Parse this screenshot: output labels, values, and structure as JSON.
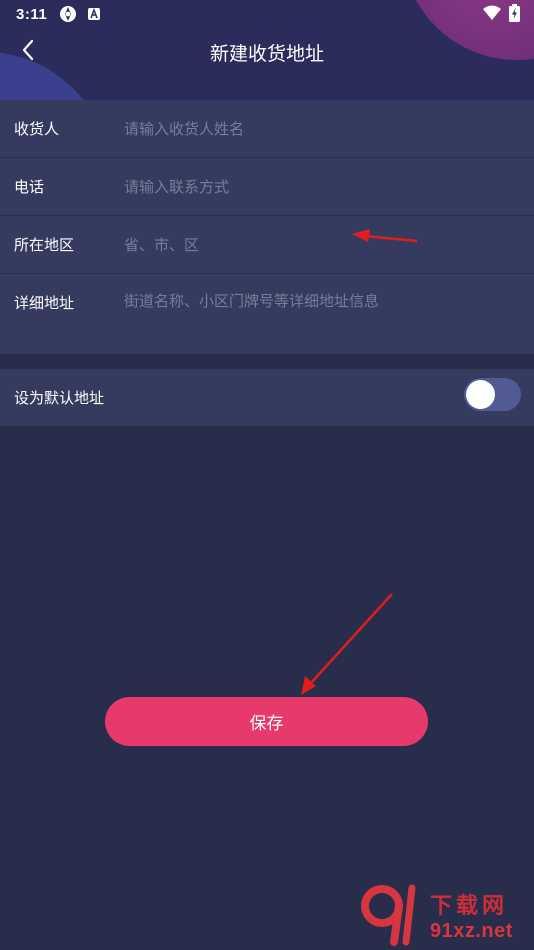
{
  "status_bar": {
    "time": "3:11",
    "left_icons": [
      "vpn-icon",
      "app-notification-icon"
    ],
    "right_icons": [
      "wifi-icon",
      "battery-charging-icon"
    ]
  },
  "header": {
    "title": "新建收货地址",
    "back_icon": "chevron-left-icon"
  },
  "form": {
    "receiver": {
      "label": "收货人",
      "placeholder": "请输入收货人姓名",
      "value": ""
    },
    "phone": {
      "label": "电话",
      "placeholder": "请输入联系方式",
      "value": ""
    },
    "region": {
      "label": "所在地区",
      "placeholder": "省、市、区",
      "value": ""
    },
    "detail": {
      "label": "详细地址",
      "placeholder": "街道名称、小区门牌号等详细地址信息",
      "value": ""
    }
  },
  "default_address": {
    "label": "设为默认地址",
    "enabled": false
  },
  "save_button": {
    "label": "保存"
  },
  "watermark": {
    "mark": "91",
    "cn_text": "下载网",
    "url_text": "91xz.net"
  },
  "colors": {
    "background": "#272d4b",
    "card": "#353b5e",
    "accent": "#e8396c",
    "annotation_arrow": "#e01e1e"
  }
}
